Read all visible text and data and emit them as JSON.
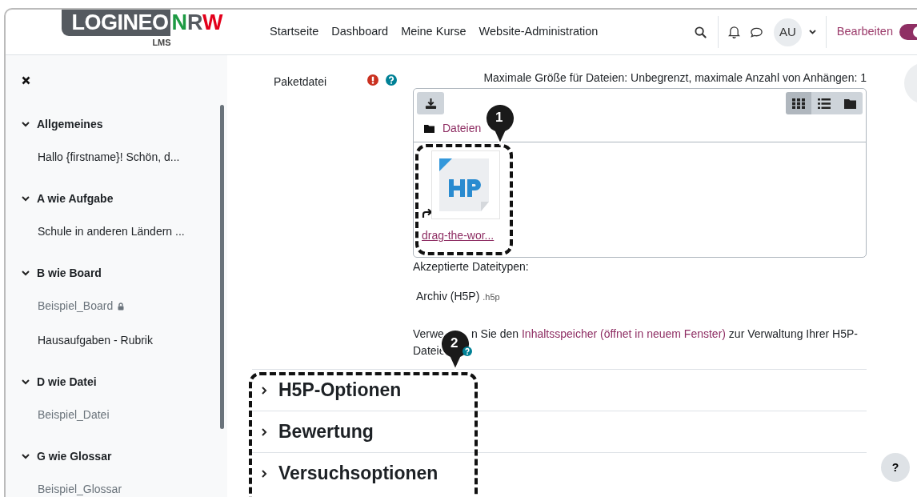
{
  "logo": {
    "word": "LOGINEO",
    "letters": [
      {
        "text": "N",
        "color": "#1d9a43"
      },
      {
        "text": "R",
        "color": "#555a60"
      },
      {
        "text": "W",
        "color": "#e3001b"
      }
    ],
    "subtitle": "LMS"
  },
  "nav_links": [
    "Startseite",
    "Dashboard",
    "Meine Kurse",
    "Website-Administration"
  ],
  "user": {
    "initials": "AU"
  },
  "edit_mode": {
    "label": "Bearbeiten",
    "on": true
  },
  "sidebar": {
    "sections": [
      {
        "title": "Allgemeines",
        "expanded": true,
        "items": [
          {
            "label": "Hallo {firstname}! Schön, d...",
            "locked": false,
            "hidden": false
          }
        ]
      },
      {
        "title": "A wie Aufgabe",
        "expanded": true,
        "items": [
          {
            "label": "Schule in anderen Ländern ...",
            "locked": false,
            "hidden": false
          }
        ]
      },
      {
        "title": "B wie Board",
        "expanded": true,
        "items": [
          {
            "label": "Beispiel_Board",
            "locked": true,
            "hidden": true
          },
          {
            "label": "Hausaufgaben - Rubrik",
            "locked": false,
            "hidden": false
          }
        ]
      },
      {
        "title": "D wie Datei",
        "expanded": true,
        "items": [
          {
            "label": "Beispiel_Datei",
            "locked": false,
            "hidden": true
          }
        ]
      },
      {
        "title": "G wie Glossar",
        "expanded": true,
        "items": [
          {
            "label": "Beispiel_Glossar",
            "locked": false,
            "hidden": true
          }
        ]
      }
    ]
  },
  "field": {
    "label": "Paketdatei",
    "required": true,
    "max_info": "Maximale Größe für Dateien: Unbegrenzt, maximale Anzahl von Anhängen: 1",
    "view_modes": [
      {
        "kind": "icons",
        "selected": true
      },
      {
        "kind": "list",
        "selected": false
      },
      {
        "kind": "tree",
        "selected": false
      }
    ],
    "path": "Dateien",
    "files": [
      {
        "name": "drag-the-wor...",
        "alias": true
      }
    ],
    "accepted_label": "Akzeptierte Dateitypen:",
    "types": [
      {
        "name": "Archiv (H5P)",
        "ext": ".h5p"
      }
    ],
    "note": {
      "start": "Verwe",
      "before": "n Sie den",
      "link": "Inhaltsspeicher (öffnet in neuem Fenster)",
      "after": "zur Verwaltung Ihrer H5P-",
      "line2": "Dateie"
    }
  },
  "sections": [
    {
      "title": "H5P-Optionen",
      "expanded": false
    },
    {
      "title": "Bewertung",
      "expanded": false
    },
    {
      "title": "Versuchsoptionen",
      "expanded": false
    }
  ],
  "annotations": [
    {
      "number": "1"
    },
    {
      "number": "2"
    }
  ],
  "help_button": "?"
}
